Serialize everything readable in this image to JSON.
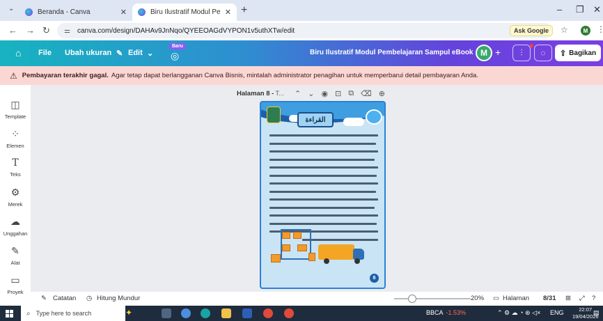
{
  "browser": {
    "tabs": [
      {
        "title": "Beranda - Canva"
      },
      {
        "title": "Biru Ilustratif Modul Pembelajar"
      }
    ],
    "url": "canva.com/design/DAHAv9JnNqo/QYEEOAGdVYPON1v5uthXTw/edit",
    "ask_google": "Ask Google",
    "profile_initial": "M"
  },
  "canva": {
    "file_label": "File",
    "resize_label": "Ubah ukuran",
    "edit_label": "Edit",
    "new_badge": "Baru",
    "doc_title": "Biru Ilustratif Modul Pembelajaran Sampul eBook",
    "avatar_initial": "M",
    "share_label": "Bagikan"
  },
  "banner": {
    "bold": "Pembayaran terakhir gagal.",
    "text": "Agar tetap dapat berlangganan Canva Bisnis, mintalah administrator penagihan untuk memperbarui detail pembayaran Anda."
  },
  "rail": {
    "items": [
      {
        "label": "Template",
        "icon": "template-icon"
      },
      {
        "label": "Elemen",
        "icon": "elements-icon"
      },
      {
        "label": "Teks",
        "icon": "text-icon"
      },
      {
        "label": "Merek",
        "icon": "brand-icon"
      },
      {
        "label": "Unggahan",
        "icon": "upload-icon"
      },
      {
        "label": "Alat",
        "icon": "pen-icon"
      },
      {
        "label": "Proyek",
        "icon": "folder-icon"
      }
    ]
  },
  "page_toolbar": {
    "page_label": "Halaman 8 -",
    "page_name": "T..."
  },
  "page": {
    "title_arabic": "القراءة",
    "page_number": "8"
  },
  "bottom": {
    "notes_label": "Catatan",
    "timer_label": "Hitung Mundur",
    "zoom": "20%",
    "pages_label": "Halaman",
    "page_count": "8/31"
  },
  "taskbar": {
    "search_placeholder": "Type here to search",
    "stock_name": "BBCA",
    "stock_change": "-1.53%",
    "lang": "ENG",
    "time": "22:07",
    "date": "19/04/2026"
  },
  "colors": {
    "canva_gradient_start": "#17b3c0",
    "canva_gradient_end": "#7b3fe4",
    "banner_bg": "#fbd7d4",
    "page_bg": "#c9e4f5",
    "page_accent": "#1e5fa8"
  }
}
